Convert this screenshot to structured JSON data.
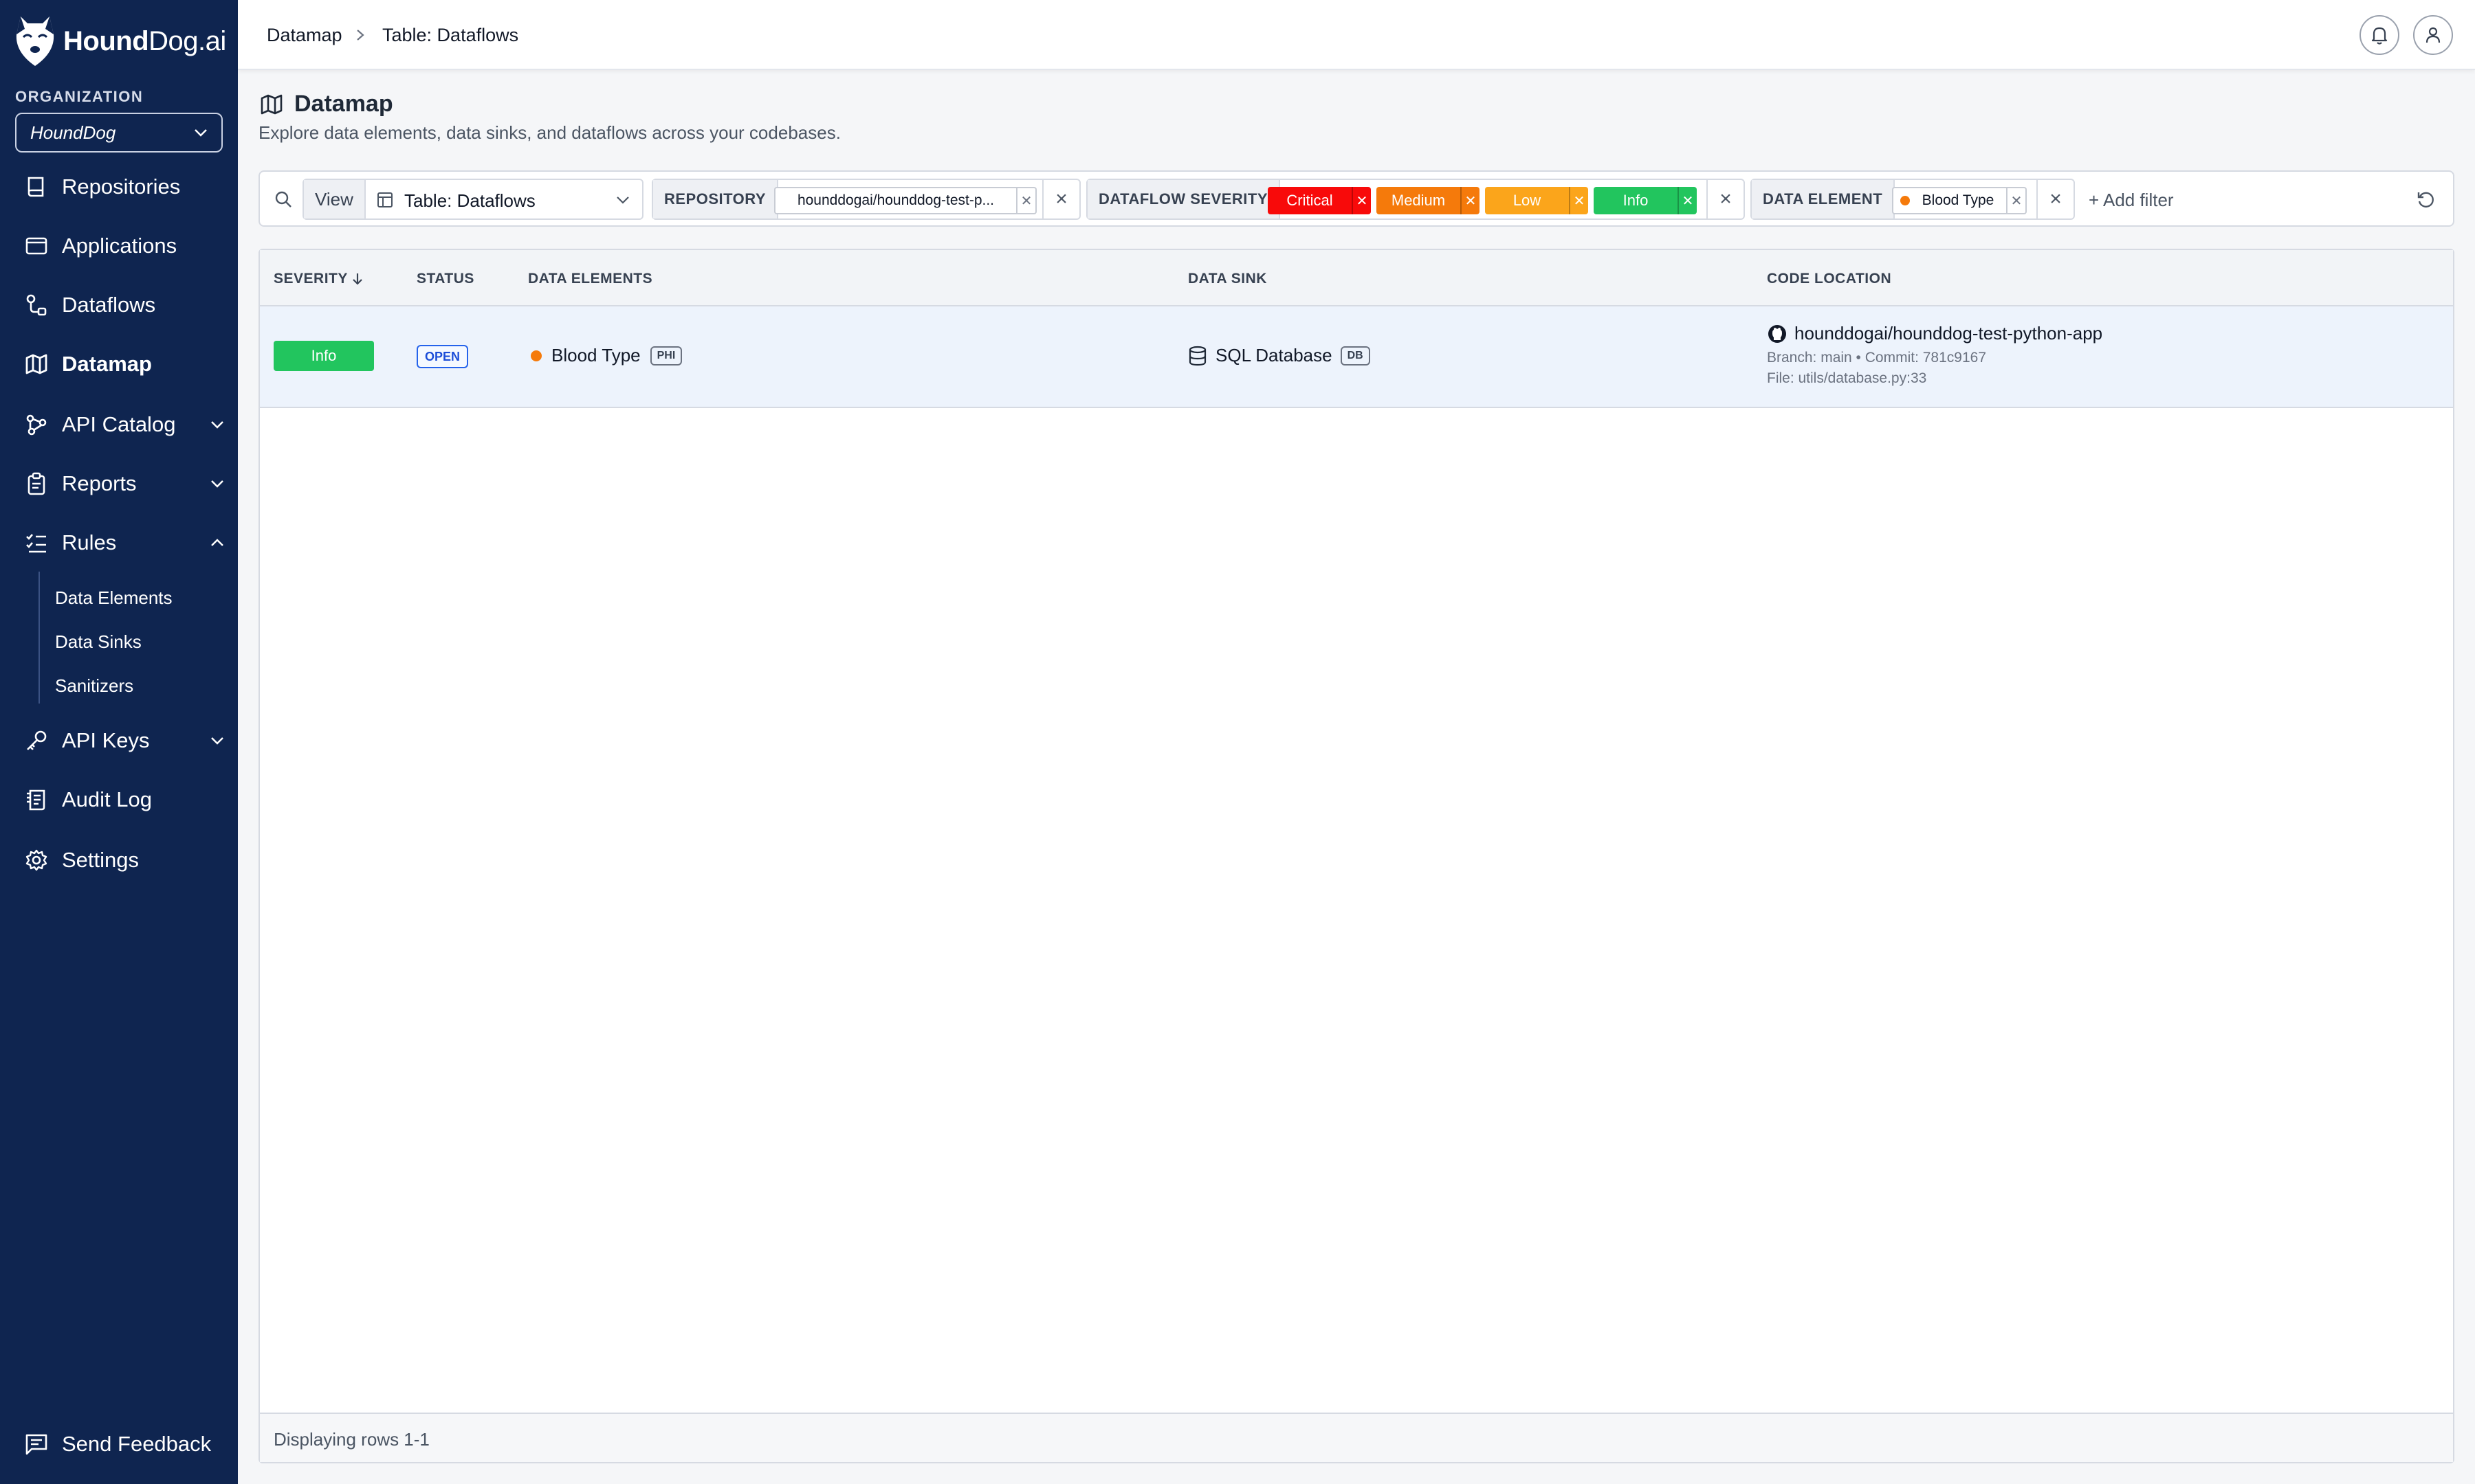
{
  "brand": {
    "logo_text_bold": "Hound",
    "logo_text_rest": "Dog.ai"
  },
  "org": {
    "label": "ORGANIZATION",
    "selected": "HoundDog"
  },
  "nav": {
    "repositories": "Repositories",
    "applications": "Applications",
    "dataflows": "Dataflows",
    "datamap": "Datamap",
    "api_catalog": "API Catalog",
    "reports": "Reports",
    "rules": "Rules",
    "rules_sub": [
      "Data Elements",
      "Data Sinks",
      "Sanitizers"
    ],
    "api_keys": "API Keys",
    "audit_log": "Audit Log",
    "settings": "Settings",
    "send_feedback": "Send Feedback"
  },
  "breadcrumb": [
    "Datamap",
    "Table: Dataflows"
  ],
  "page": {
    "title": "Datamap",
    "subtitle": "Explore data elements, data sinks, and dataflows across your codebases."
  },
  "filters": {
    "view_label": "View",
    "view_value": "Table: Dataflows",
    "repository_label": "REPOSITORY",
    "repository_value": "hounddogai/hounddog-test-p...",
    "severity_label": "DATAFLOW SEVERITY",
    "severities": [
      {
        "label": "Critical",
        "color": "#f80a0a"
      },
      {
        "label": "Medium",
        "color": "#f57a0b"
      },
      {
        "label": "Low",
        "color": "#fba51b"
      },
      {
        "label": "Info",
        "color": "#22c55e"
      }
    ],
    "data_element_label": "DATA ELEMENT",
    "data_element_value": "Blood Type",
    "add_filter": "+ Add filter"
  },
  "table": {
    "columns": [
      "SEVERITY",
      "STATUS",
      "DATA ELEMENTS",
      "DATA SINK",
      "CODE LOCATION"
    ],
    "rows": [
      {
        "severity": "Info",
        "severity_color": "#22c55e",
        "status": "OPEN",
        "element": "Blood Type",
        "element_tag": "PHI",
        "element_dot_color": "#f57a0b",
        "sink": "SQL Database",
        "sink_tag": "DB",
        "repo": "hounddogai/hounddog-test-python-app",
        "branch_commit": "Branch: main • Commit: 781c9167",
        "file": "File: utils/database.py:33"
      }
    ],
    "footer": "Displaying rows 1-1"
  }
}
